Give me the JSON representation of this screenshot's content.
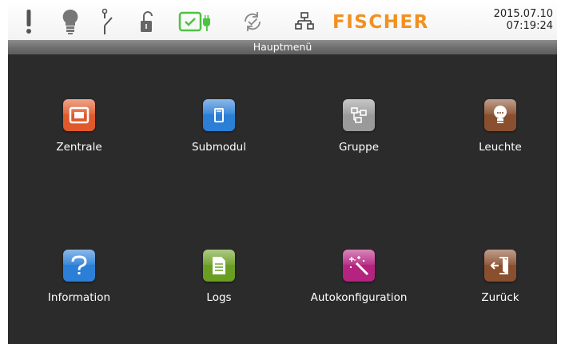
{
  "statusbar": {
    "brand": "FISCHER",
    "date": "2015.07.10",
    "time": "07:19:24"
  },
  "title": "Hauptmenü",
  "menu": [
    {
      "label": "Zentrale",
      "icon": "central-unit-icon",
      "color": "#e0592a"
    },
    {
      "label": "Submodul",
      "icon": "submodule-icon",
      "color": "#2b7fd6"
    },
    {
      "label": "Gruppe",
      "icon": "group-icon",
      "color": "#9a9a9a"
    },
    {
      "label": "Leuchte",
      "icon": "lamp-icon",
      "color": "#8a4f2e"
    },
    {
      "label": "Information",
      "icon": "question-icon",
      "color": "#2b7fd6"
    },
    {
      "label": "Logs",
      "icon": "document-icon",
      "color": "#6a9e22"
    },
    {
      "label": "Autokonfiguration",
      "icon": "magic-wand-icon",
      "color": "#b4237f"
    },
    {
      "label": "Zurück",
      "icon": "exit-door-icon",
      "color": "#8a4f2e"
    }
  ],
  "colors": {
    "brand": "#f29120",
    "background": "#2b2b2b",
    "battery_ok": "#4cc341"
  }
}
